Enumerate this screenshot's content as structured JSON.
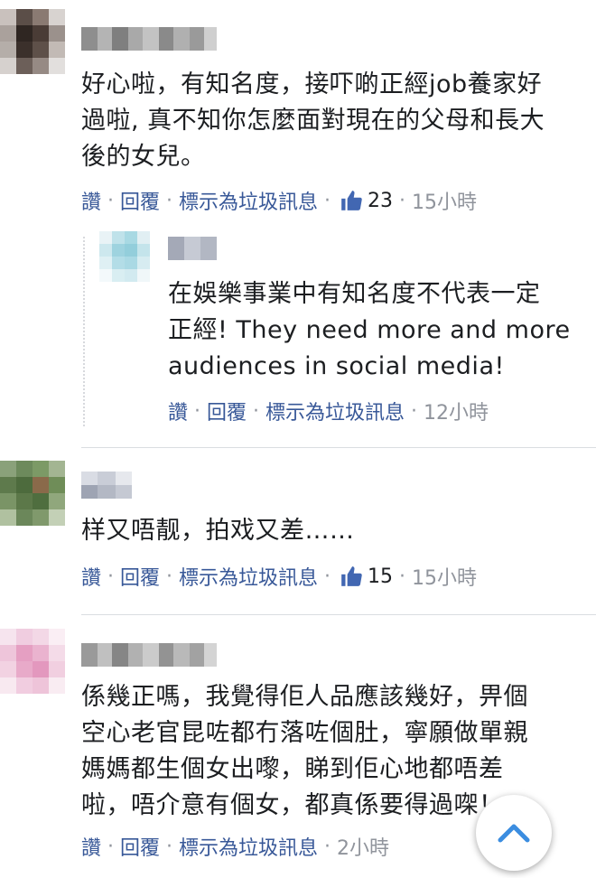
{
  "comments": [
    {
      "text": "好心啦，有知名度，接吓啲正經job養家好\n過啦, 真不知你怎麼面對現在的父母和長大\n後的女兒。",
      "actions": {
        "like": "讚",
        "reply": "回覆",
        "spam": "標示為垃圾訊息",
        "likes": "23",
        "time": "15小時"
      }
    },
    {
      "text": "在娛樂事業中有知名度不代表一定\n正經! They need more and more\naudiences in social media!",
      "actions": {
        "like": "讚",
        "reply": "回覆",
        "spam": "標示為垃圾訊息",
        "time": "12小時"
      }
    },
    {
      "text": "样又唔靓，拍戏又差……",
      "actions": {
        "like": "讚",
        "reply": "回覆",
        "spam": "標示為垃圾訊息",
        "likes": "15",
        "time": "15小時"
      }
    },
    {
      "text": "係幾正嗎，我覺得佢人品應該幾好，畀個\n空心老官昆咗都冇落咗個肚，寧願做單親\n媽媽都生個女出嚟，睇到佢心地都唔差\n啦，唔介意有個女，都真係要得過㗎！",
      "actions": {
        "like": "讚",
        "reply": "回覆",
        "spam": "標示為垃圾訊息",
        "time": "2小時"
      }
    }
  ],
  "icons": {
    "like": "thumbs-up-icon",
    "scroll": "chevron-up-icon"
  },
  "colors": {
    "link": "#385898",
    "meta": "#90949c",
    "like_blue": "#4267b2",
    "scroll_arrow": "#3b8de0"
  }
}
